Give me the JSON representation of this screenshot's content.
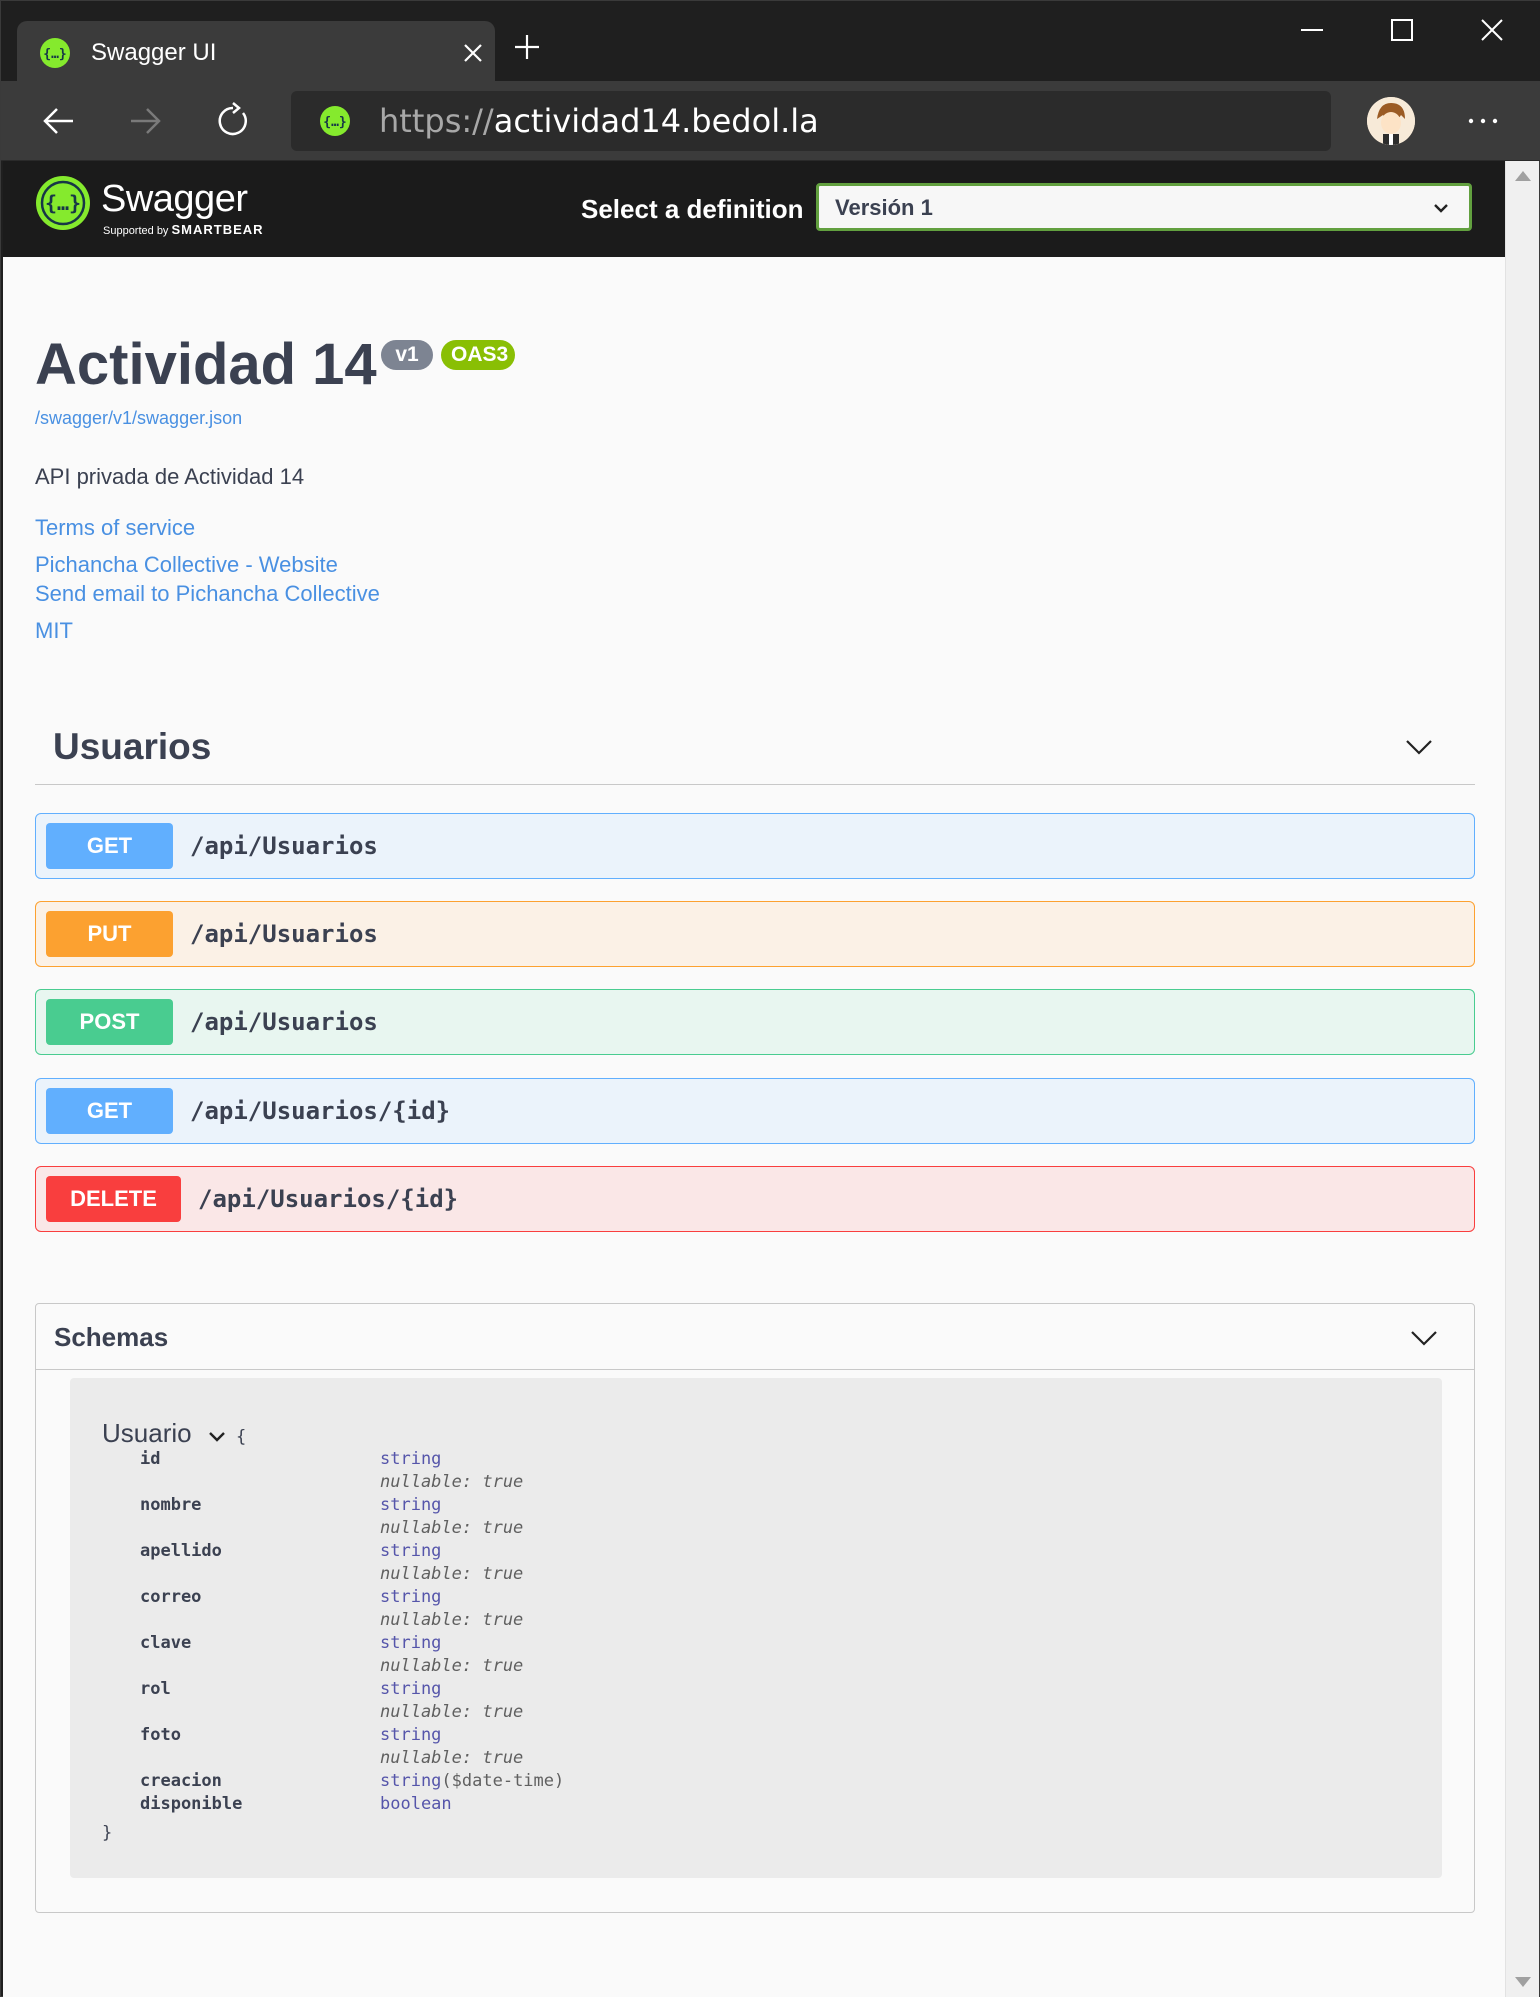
{
  "browser": {
    "tab_title": "Swagger UI",
    "url_scheme": "https://",
    "url_host": "actividad14.bedol.la"
  },
  "swagger": {
    "logo_word": "Swagger",
    "logo_supported": "Supported by",
    "logo_brand": "SMARTBEAR",
    "select_label": "Select a definition",
    "selected_definition": "Versión 1"
  },
  "info": {
    "title": "Actividad 14",
    "version_badge": "v1",
    "oas_badge": "OAS3",
    "spec_url": "/swagger/v1/swagger.json",
    "description": "API privada de Actividad 14",
    "terms": "Terms of service",
    "contact_website": "Pichancha Collective - Website",
    "contact_email": "Send email to Pichancha Collective",
    "license": "MIT"
  },
  "tag": {
    "name": "Usuarios"
  },
  "operations": [
    {
      "method": "GET",
      "path": "/api/Usuarios"
    },
    {
      "method": "PUT",
      "path": "/api/Usuarios"
    },
    {
      "method": "POST",
      "path": "/api/Usuarios"
    },
    {
      "method": "GET",
      "path": "/api/Usuarios/{id}"
    },
    {
      "method": "DELETE",
      "path": "/api/Usuarios/{id}"
    }
  ],
  "schemas": {
    "label": "Schemas",
    "model_name": "Usuario",
    "open_brace": "{",
    "close_brace": "}",
    "properties": [
      {
        "name": "id",
        "type": "string",
        "nullable": "nullable: true"
      },
      {
        "name": "nombre",
        "type": "string",
        "nullable": "nullable: true"
      },
      {
        "name": "apellido",
        "type": "string",
        "nullable": "nullable: true"
      },
      {
        "name": "correo",
        "type": "string",
        "nullable": "nullable: true"
      },
      {
        "name": "clave",
        "type": "string",
        "nullable": "nullable: true"
      },
      {
        "name": "rol",
        "type": "string",
        "nullable": "nullable: true"
      },
      {
        "name": "foto",
        "type": "string",
        "nullable": "nullable: true"
      },
      {
        "name": "creacion",
        "type": "string",
        "format": "($date-time)"
      },
      {
        "name": "disponible",
        "type": "boolean"
      }
    ]
  },
  "colors": {
    "get": "#61affe",
    "put": "#fca130",
    "post": "#49cc90",
    "delete": "#f93e3e",
    "swagger_green": "#85ea2d",
    "select_border": "#62a03f"
  }
}
